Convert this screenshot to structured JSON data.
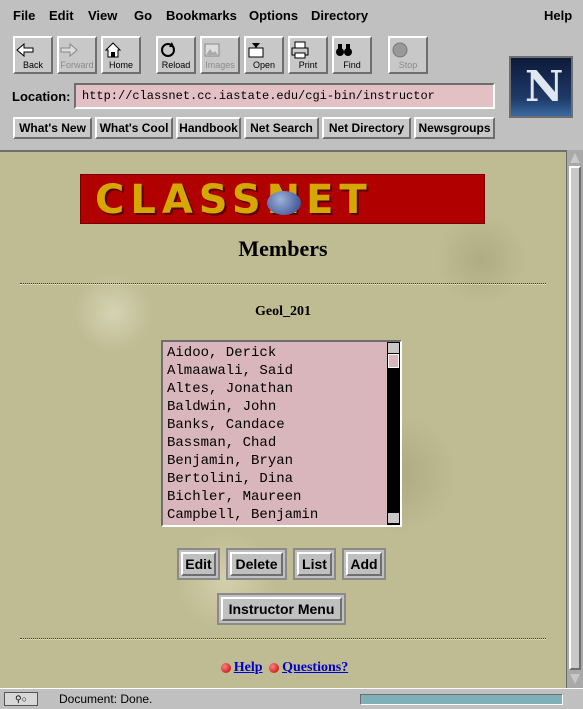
{
  "menu": {
    "file": "File",
    "edit": "Edit",
    "view": "View",
    "go": "Go",
    "bookmarks": "Bookmarks",
    "options": "Options",
    "directory": "Directory",
    "help": "Help"
  },
  "toolbar": {
    "back": "Back",
    "forward": "Forward",
    "home": "Home",
    "reload": "Reload",
    "images": "Images",
    "open": "Open",
    "print": "Print",
    "find": "Find",
    "stop": "Stop"
  },
  "location": {
    "label": "Location:",
    "url": "http://classnet.cc.iastate.edu/cgi-bin/instructor"
  },
  "directory_buttons": {
    "whats_new": "What's New",
    "whats_cool": "What's Cool",
    "handbook": "Handbook",
    "net_search": "Net Search",
    "net_directory": "Net Directory",
    "newsgroups": "Newsgroups"
  },
  "logo": {
    "letter": "N"
  },
  "page": {
    "banner_text": "CLASSNET",
    "title": "Members",
    "course": "Geol_201",
    "members": [
      "Aidoo, Derick",
      "Almaawali, Said",
      "Altes, Jonathan",
      "Baldwin, John",
      "Banks, Candace",
      "Bassman, Chad",
      "Benjamin, Bryan",
      "Bertolini, Dina",
      "Bichler, Maureen",
      "Campbell, Benjamin"
    ],
    "buttons": {
      "edit": "Edit",
      "delete": "Delete",
      "list": "List",
      "add": "Add",
      "instructor_menu": "Instructor Menu"
    },
    "links": {
      "help": "Help",
      "questions": "Questions?"
    }
  },
  "status": {
    "message": "Document: Done."
  },
  "colors": {
    "background": "#bfbb92",
    "banner": "#b00000",
    "listbox": "#d9b6bb",
    "link": "#0000cc"
  }
}
